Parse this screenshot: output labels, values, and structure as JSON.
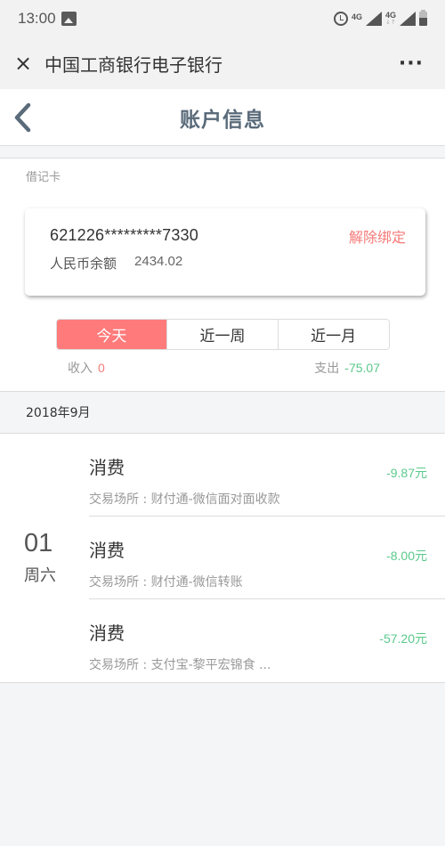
{
  "status_bar": {
    "time": "13:00",
    "network_1": "4G",
    "network_2": "4G"
  },
  "app_header": {
    "title": "中国工商银行电子银行",
    "close_icon": "×",
    "more_icon": "···"
  },
  "page": {
    "title": "账户信息"
  },
  "card": {
    "type_label": "借记卡",
    "number": "621226*********7330",
    "unbind_label": "解除绑定",
    "balance_label": "人民币余额",
    "balance_value": "2434.02"
  },
  "tabs": [
    {
      "label": "今天",
      "active": true
    },
    {
      "label": "近一周",
      "active": false
    },
    {
      "label": "近一月",
      "active": false
    }
  ],
  "summary": {
    "income_label": "收入",
    "income_value": "0",
    "expense_label": "支出",
    "expense_value": "-75.07"
  },
  "month": "2018年9月",
  "day_group": {
    "day": "01",
    "weekday": "周六",
    "transactions": [
      {
        "type": "消费",
        "place": "交易场所 : 财付通-微信面对面收款",
        "amount": "-9.87",
        "currency": "元"
      },
      {
        "type": "消费",
        "place": "交易场所 : 财付通-微信转账",
        "amount": "-8.00",
        "currency": "元"
      },
      {
        "type": "消费",
        "place": "交易场所 : 支付宝-黎平宏锦食 ...",
        "amount": "-57.20",
        "currency": "元"
      }
    ]
  },
  "colors": {
    "accent_red": "#ff7b7b",
    "unbind_red": "#f57a78",
    "expense_green": "#5ac98c",
    "title_slate": "#5a6b7a"
  }
}
